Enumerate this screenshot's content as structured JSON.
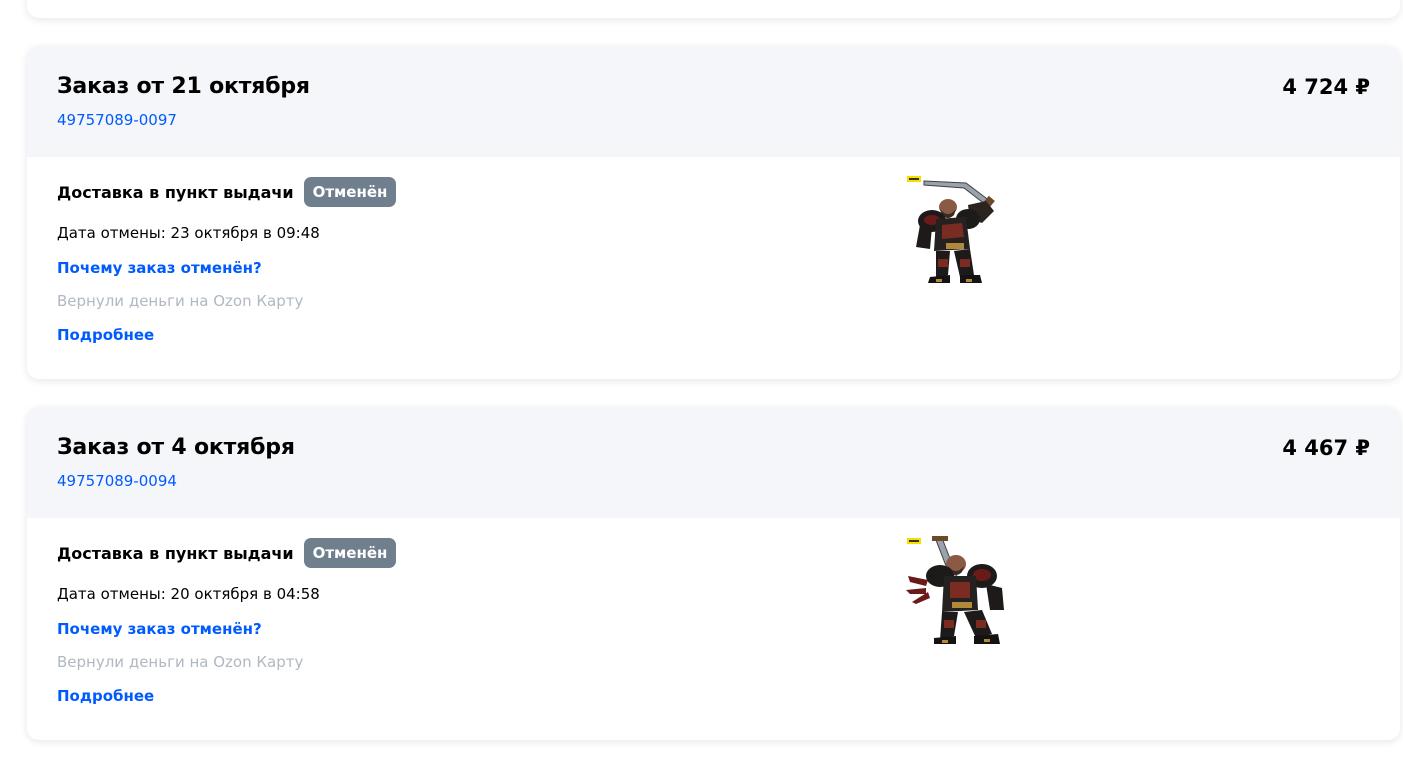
{
  "orders": [
    {
      "title": "Заказ от 21 октября",
      "number": "49757089-0097",
      "price": "4 724 ₽",
      "delivery_type": "Доставка в пункт выдачи",
      "status": "Отменён",
      "cancel_date": "Дата отмены: 23 октября в 09:48",
      "why_link": "Почему заказ отменён?",
      "refund_note": "Вернули деньги на Ozon Карту",
      "details_link": "Подробнее",
      "product_image": "warhammer-space-marine-figure"
    },
    {
      "title": "Заказ от 4 октября",
      "number": "49757089-0094",
      "price": "4 467 ₽",
      "delivery_type": "Доставка в пункт выдачи",
      "status": "Отменён",
      "cancel_date": "Дата отмены: 20 октября в 04:58",
      "why_link": "Почему заказ отменён?",
      "refund_note": "Вернули деньги на Ozon Карту",
      "details_link": "Подробнее",
      "product_image": "warhammer-space-marine-figure-claws"
    }
  ],
  "colors": {
    "link": "#005bff",
    "header_bg": "#f5f6f9",
    "badge_bg": "#707f8d",
    "muted_text": "#b0b8c1"
  }
}
